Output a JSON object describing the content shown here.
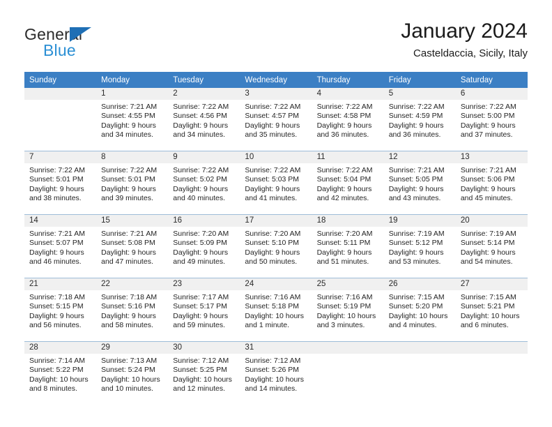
{
  "brand": {
    "name_part1": "General",
    "name_part2": "Blue",
    "triangle_color": "#1f6fb5",
    "blue_color": "#2b8fd4"
  },
  "header": {
    "title": "January 2024",
    "subtitle": "Casteldaccia, Sicily, Italy"
  },
  "theme": {
    "header_band": "#3b7fc4",
    "daynum_band": "#f0f0f0",
    "grid_line": "#9dbcd8",
    "text": "#242424"
  },
  "calendar": {
    "weekday_headers": [
      "Sunday",
      "Monday",
      "Tuesday",
      "Wednesday",
      "Thursday",
      "Friday",
      "Saturday"
    ],
    "weeks": [
      [
        {
          "day": "",
          "sunrise": "",
          "sunset": "",
          "daylight_1": "",
          "daylight_2": ""
        },
        {
          "day": "1",
          "sunrise": "Sunrise: 7:21 AM",
          "sunset": "Sunset: 4:55 PM",
          "daylight_1": "Daylight: 9 hours",
          "daylight_2": "and 34 minutes."
        },
        {
          "day": "2",
          "sunrise": "Sunrise: 7:22 AM",
          "sunset": "Sunset: 4:56 PM",
          "daylight_1": "Daylight: 9 hours",
          "daylight_2": "and 34 minutes."
        },
        {
          "day": "3",
          "sunrise": "Sunrise: 7:22 AM",
          "sunset": "Sunset: 4:57 PM",
          "daylight_1": "Daylight: 9 hours",
          "daylight_2": "and 35 minutes."
        },
        {
          "day": "4",
          "sunrise": "Sunrise: 7:22 AM",
          "sunset": "Sunset: 4:58 PM",
          "daylight_1": "Daylight: 9 hours",
          "daylight_2": "and 36 minutes."
        },
        {
          "day": "5",
          "sunrise": "Sunrise: 7:22 AM",
          "sunset": "Sunset: 4:59 PM",
          "daylight_1": "Daylight: 9 hours",
          "daylight_2": "and 36 minutes."
        },
        {
          "day": "6",
          "sunrise": "Sunrise: 7:22 AM",
          "sunset": "Sunset: 5:00 PM",
          "daylight_1": "Daylight: 9 hours",
          "daylight_2": "and 37 minutes."
        }
      ],
      [
        {
          "day": "7",
          "sunrise": "Sunrise: 7:22 AM",
          "sunset": "Sunset: 5:01 PM",
          "daylight_1": "Daylight: 9 hours",
          "daylight_2": "and 38 minutes."
        },
        {
          "day": "8",
          "sunrise": "Sunrise: 7:22 AM",
          "sunset": "Sunset: 5:01 PM",
          "daylight_1": "Daylight: 9 hours",
          "daylight_2": "and 39 minutes."
        },
        {
          "day": "9",
          "sunrise": "Sunrise: 7:22 AM",
          "sunset": "Sunset: 5:02 PM",
          "daylight_1": "Daylight: 9 hours",
          "daylight_2": "and 40 minutes."
        },
        {
          "day": "10",
          "sunrise": "Sunrise: 7:22 AM",
          "sunset": "Sunset: 5:03 PM",
          "daylight_1": "Daylight: 9 hours",
          "daylight_2": "and 41 minutes."
        },
        {
          "day": "11",
          "sunrise": "Sunrise: 7:22 AM",
          "sunset": "Sunset: 5:04 PM",
          "daylight_1": "Daylight: 9 hours",
          "daylight_2": "and 42 minutes."
        },
        {
          "day": "12",
          "sunrise": "Sunrise: 7:21 AM",
          "sunset": "Sunset: 5:05 PM",
          "daylight_1": "Daylight: 9 hours",
          "daylight_2": "and 43 minutes."
        },
        {
          "day": "13",
          "sunrise": "Sunrise: 7:21 AM",
          "sunset": "Sunset: 5:06 PM",
          "daylight_1": "Daylight: 9 hours",
          "daylight_2": "and 45 minutes."
        }
      ],
      [
        {
          "day": "14",
          "sunrise": "Sunrise: 7:21 AM",
          "sunset": "Sunset: 5:07 PM",
          "daylight_1": "Daylight: 9 hours",
          "daylight_2": "and 46 minutes."
        },
        {
          "day": "15",
          "sunrise": "Sunrise: 7:21 AM",
          "sunset": "Sunset: 5:08 PM",
          "daylight_1": "Daylight: 9 hours",
          "daylight_2": "and 47 minutes."
        },
        {
          "day": "16",
          "sunrise": "Sunrise: 7:20 AM",
          "sunset": "Sunset: 5:09 PM",
          "daylight_1": "Daylight: 9 hours",
          "daylight_2": "and 49 minutes."
        },
        {
          "day": "17",
          "sunrise": "Sunrise: 7:20 AM",
          "sunset": "Sunset: 5:10 PM",
          "daylight_1": "Daylight: 9 hours",
          "daylight_2": "and 50 minutes."
        },
        {
          "day": "18",
          "sunrise": "Sunrise: 7:20 AM",
          "sunset": "Sunset: 5:11 PM",
          "daylight_1": "Daylight: 9 hours",
          "daylight_2": "and 51 minutes."
        },
        {
          "day": "19",
          "sunrise": "Sunrise: 7:19 AM",
          "sunset": "Sunset: 5:12 PM",
          "daylight_1": "Daylight: 9 hours",
          "daylight_2": "and 53 minutes."
        },
        {
          "day": "20",
          "sunrise": "Sunrise: 7:19 AM",
          "sunset": "Sunset: 5:14 PM",
          "daylight_1": "Daylight: 9 hours",
          "daylight_2": "and 54 minutes."
        }
      ],
      [
        {
          "day": "21",
          "sunrise": "Sunrise: 7:18 AM",
          "sunset": "Sunset: 5:15 PM",
          "daylight_1": "Daylight: 9 hours",
          "daylight_2": "and 56 minutes."
        },
        {
          "day": "22",
          "sunrise": "Sunrise: 7:18 AM",
          "sunset": "Sunset: 5:16 PM",
          "daylight_1": "Daylight: 9 hours",
          "daylight_2": "and 58 minutes."
        },
        {
          "day": "23",
          "sunrise": "Sunrise: 7:17 AM",
          "sunset": "Sunset: 5:17 PM",
          "daylight_1": "Daylight: 9 hours",
          "daylight_2": "and 59 minutes."
        },
        {
          "day": "24",
          "sunrise": "Sunrise: 7:16 AM",
          "sunset": "Sunset: 5:18 PM",
          "daylight_1": "Daylight: 10 hours",
          "daylight_2": "and 1 minute."
        },
        {
          "day": "25",
          "sunrise": "Sunrise: 7:16 AM",
          "sunset": "Sunset: 5:19 PM",
          "daylight_1": "Daylight: 10 hours",
          "daylight_2": "and 3 minutes."
        },
        {
          "day": "26",
          "sunrise": "Sunrise: 7:15 AM",
          "sunset": "Sunset: 5:20 PM",
          "daylight_1": "Daylight: 10 hours",
          "daylight_2": "and 4 minutes."
        },
        {
          "day": "27",
          "sunrise": "Sunrise: 7:15 AM",
          "sunset": "Sunset: 5:21 PM",
          "daylight_1": "Daylight: 10 hours",
          "daylight_2": "and 6 minutes."
        }
      ],
      [
        {
          "day": "28",
          "sunrise": "Sunrise: 7:14 AM",
          "sunset": "Sunset: 5:22 PM",
          "daylight_1": "Daylight: 10 hours",
          "daylight_2": "and 8 minutes."
        },
        {
          "day": "29",
          "sunrise": "Sunrise: 7:13 AM",
          "sunset": "Sunset: 5:24 PM",
          "daylight_1": "Daylight: 10 hours",
          "daylight_2": "and 10 minutes."
        },
        {
          "day": "30",
          "sunrise": "Sunrise: 7:12 AM",
          "sunset": "Sunset: 5:25 PM",
          "daylight_1": "Daylight: 10 hours",
          "daylight_2": "and 12 minutes."
        },
        {
          "day": "31",
          "sunrise": "Sunrise: 7:12 AM",
          "sunset": "Sunset: 5:26 PM",
          "daylight_1": "Daylight: 10 hours",
          "daylight_2": "and 14 minutes."
        },
        {
          "day": "",
          "sunrise": "",
          "sunset": "",
          "daylight_1": "",
          "daylight_2": ""
        },
        {
          "day": "",
          "sunrise": "",
          "sunset": "",
          "daylight_1": "",
          "daylight_2": ""
        },
        {
          "day": "",
          "sunrise": "",
          "sunset": "",
          "daylight_1": "",
          "daylight_2": ""
        }
      ]
    ]
  }
}
